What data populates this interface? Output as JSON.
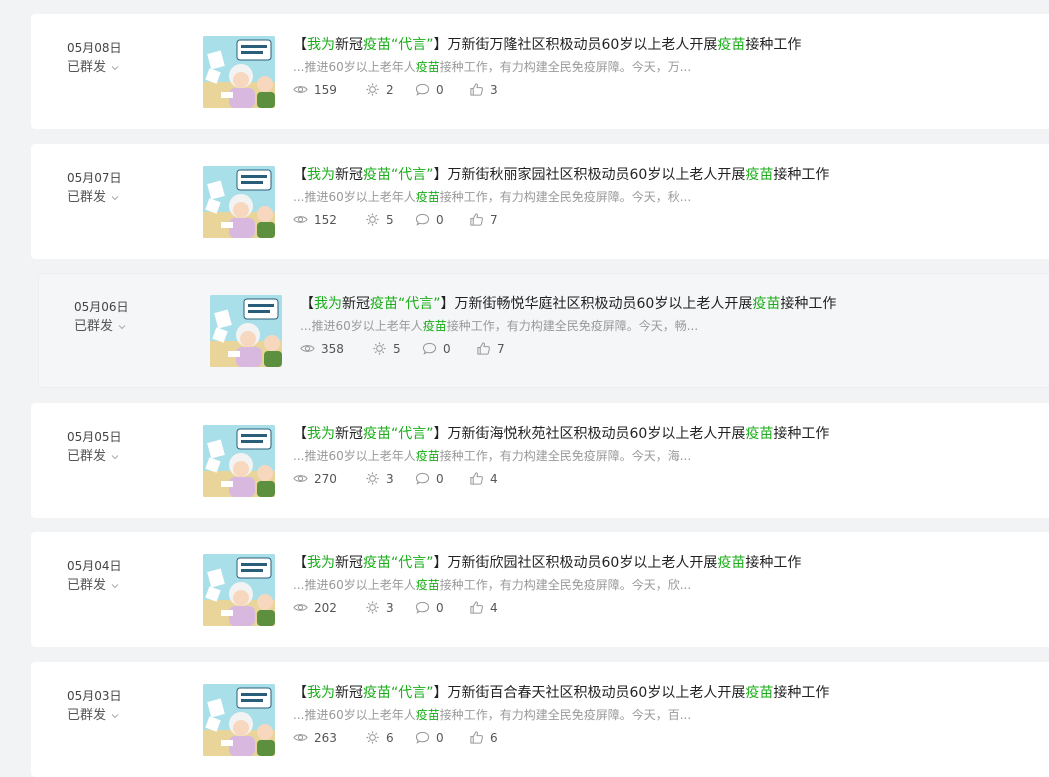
{
  "status_label": "已群发",
  "excerpt_pre": "...推进60岁以上老年人",
  "excerpt_hl": "疫苗",
  "title_parts": {
    "open": "【",
    "wo_wei": "我为",
    "xinguan": "新冠",
    "yimiao": "疫苗",
    "daiyan": "“代言”",
    "close": "】"
  },
  "title_mid_suffix": "社区积极动员60岁以上老人开展",
  "title_vaccine": "疫苗",
  "title_end": "接种工作",
  "colors": {
    "accent": "#1aad19",
    "card_bg": "#ffffff",
    "page_bg": "#f2f3f5"
  },
  "articles": [
    {
      "date": "05月08日",
      "community": "万新街万隆",
      "excerpt_post": "接种工作，有力构建全民免疫屏障。今天，万...",
      "views": "159",
      "shares": "2",
      "comments": "0",
      "likes": "3"
    },
    {
      "date": "05月07日",
      "community": "万新街秋丽家园",
      "excerpt_post": "接种工作，有力构建全民免疫屏障。今天，秋...",
      "views": "152",
      "shares": "5",
      "comments": "0",
      "likes": "7"
    },
    {
      "date": "05月06日",
      "community": "万新街畅悦华庭",
      "excerpt_post": "接种工作，有力构建全民免疫屏障。今天，畅...",
      "views": "358",
      "shares": "5",
      "comments": "0",
      "likes": "7"
    },
    {
      "date": "05月05日",
      "community": "万新街海悦秋苑",
      "excerpt_post": "接种工作，有力构建全民免疫屏障。今天，海...",
      "views": "270",
      "shares": "3",
      "comments": "0",
      "likes": "4"
    },
    {
      "date": "05月04日",
      "community": "万新街欣园",
      "excerpt_post": "接种工作，有力构建全民免疫屏障。今天，欣...",
      "views": "202",
      "shares": "3",
      "comments": "0",
      "likes": "4"
    },
    {
      "date": "05月03日",
      "community": "万新街百合春天",
      "excerpt_post": "接种工作，有力构建全民免疫屏障。今天，百...",
      "views": "263",
      "shares": "6",
      "comments": "0",
      "likes": "6"
    }
  ]
}
